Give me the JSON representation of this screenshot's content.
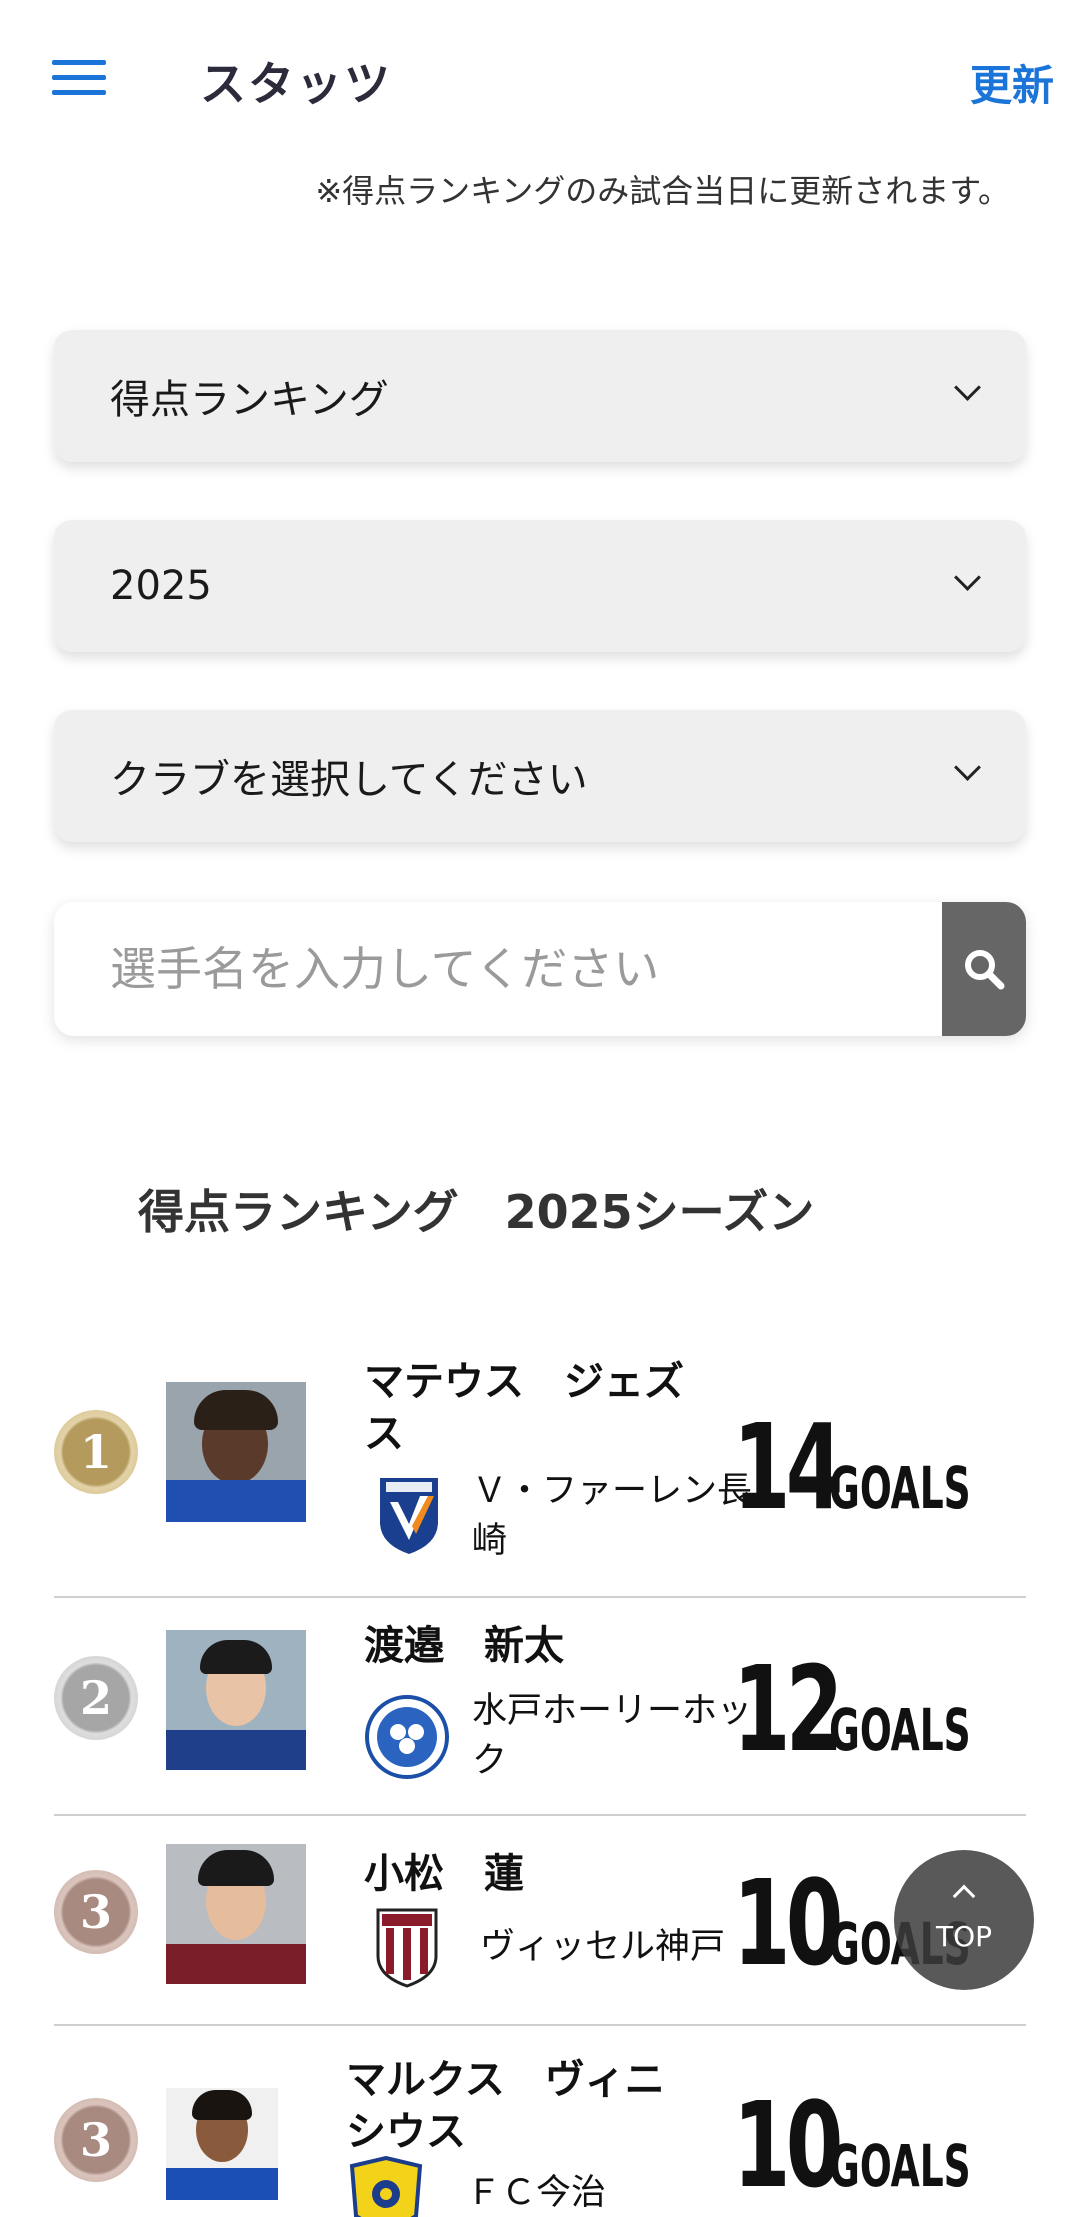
{
  "header": {
    "title": "スタッツ",
    "refresh_label": "更新",
    "menu_icon": "hamburger-menu-icon"
  },
  "notice": "※得点ランキングのみ試合当日に更新されます。",
  "filters": {
    "type_selected": "得点ランキング",
    "year_selected": "2025",
    "club_selected": "クラブを選択してください"
  },
  "search": {
    "placeholder": "選手名を入力してください",
    "icon": "search-icon"
  },
  "section_title": "得点ランキング　2025シーズン",
  "ranking": [
    {
      "rank": "1",
      "medal": "gold",
      "name": "マテウス　ジェズス",
      "club": "Ｖ・ファーレン長崎",
      "goals": "14",
      "unit": "GOALS"
    },
    {
      "rank": "2",
      "medal": "silver",
      "name": "渡邉　新太",
      "club": "水戸ホーリーホック",
      "goals": "12",
      "unit": "GOALS"
    },
    {
      "rank": "3",
      "medal": "bronze",
      "name": "小松　蓮",
      "club": "ヴィッセル神戸",
      "goals": "10",
      "unit": "GOALS"
    },
    {
      "rank": "3",
      "medal": "bronze",
      "name": "マルクス　ヴィニシウス",
      "club": "ＦＣ今治",
      "goals": "10",
      "unit": "GOALS"
    }
  ],
  "top_button": {
    "label": "TOP"
  },
  "colors": {
    "accent": "#1b74d8",
    "gold": "#b49a5c",
    "silver": "#a6a6a6",
    "bronze": "#a88a81"
  }
}
